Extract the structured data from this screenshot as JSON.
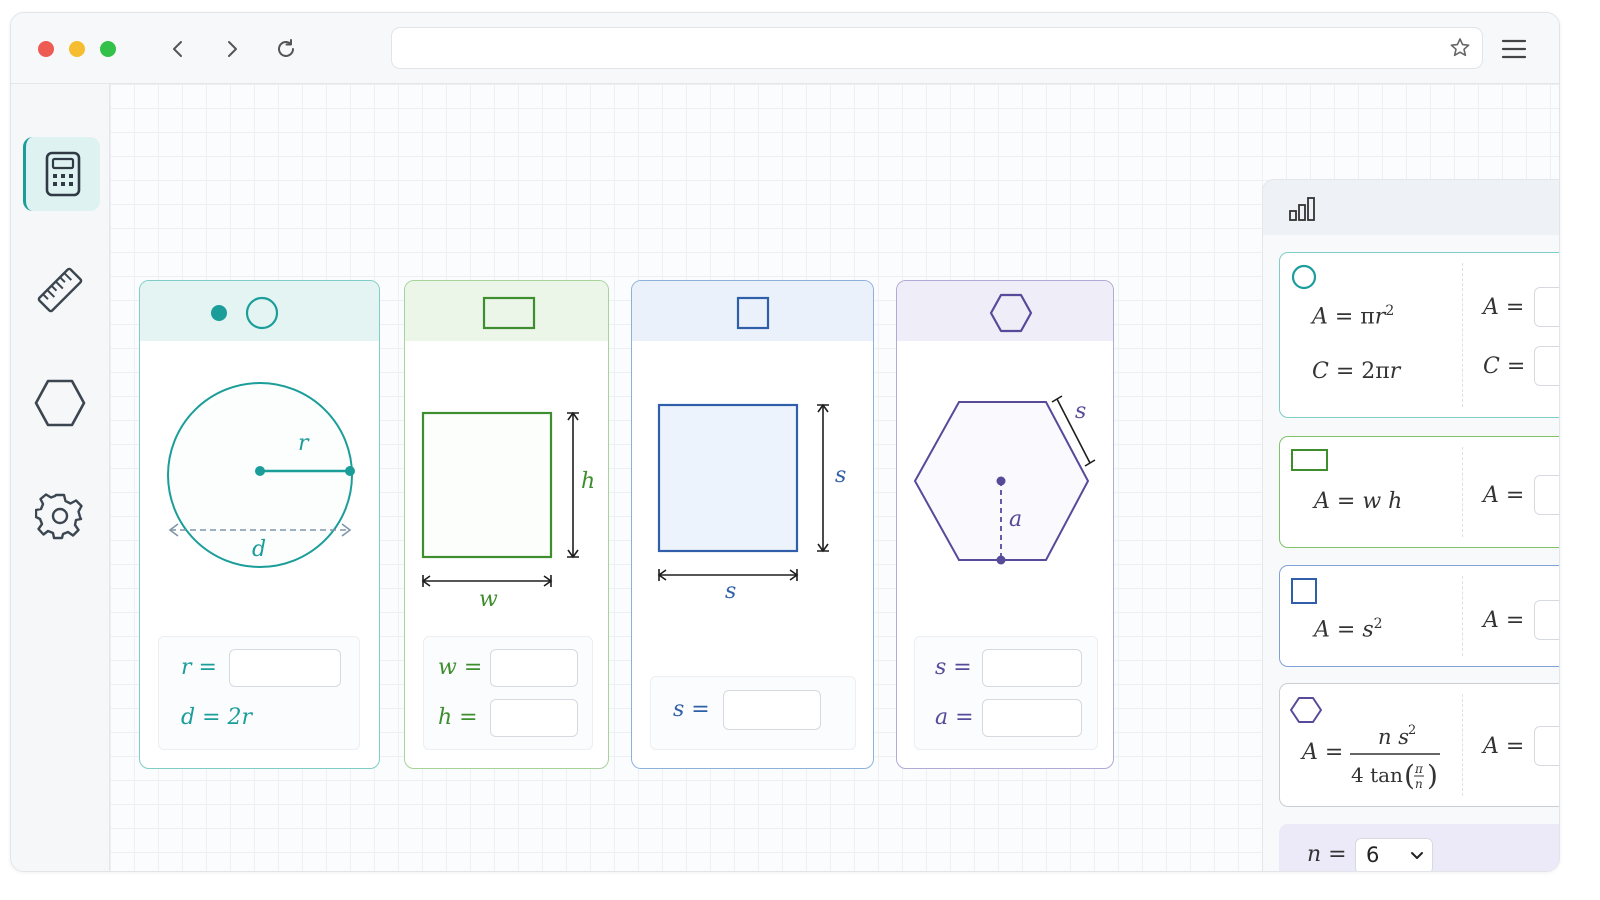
{
  "sidebar": {
    "items": [
      {
        "name": "calculator",
        "icon": "calculator-icon",
        "active": true
      },
      {
        "name": "ruler",
        "icon": "ruler-icon",
        "active": false
      },
      {
        "name": "hexagon",
        "icon": "hexagon-icon",
        "active": false
      },
      {
        "name": "settings",
        "icon": "gear-icon",
        "active": false
      }
    ]
  },
  "colors": {
    "circle": "#1b9d9a",
    "rectangle": "#3e8e2f",
    "square": "#2f5fa8",
    "hexagon": "#564a9a"
  },
  "shapes": {
    "circle": {
      "label_radius": "r",
      "label_diameter": "d",
      "input_label": "r =",
      "note_label": "d = 2r"
    },
    "rectangle": {
      "label_width": "w",
      "label_height": "h",
      "input_w_label": "w =",
      "input_h_label": "h ="
    },
    "square": {
      "label_side_v": "s",
      "label_side_h": "s",
      "input_label": "s ="
    },
    "hexagon": {
      "label_side": "s",
      "label_apothem": "a",
      "input_s_label": "s =",
      "input_a_label": "a ="
    }
  },
  "panel": {
    "header_icon": "bar-chart-icon",
    "circle": {
      "area_formula_lhs": "A",
      "circ_formula_lhs": "C",
      "area_label": "A =",
      "circ_label": "C ="
    },
    "rectangle": {
      "formula_lhs": "A",
      "area_label": "A ="
    },
    "square": {
      "formula_lhs": "A",
      "area_label": "A ="
    },
    "hexagon": {
      "formula_lhs": "A",
      "area_label": "A ="
    },
    "n_label": "n =",
    "n_value": "6"
  }
}
